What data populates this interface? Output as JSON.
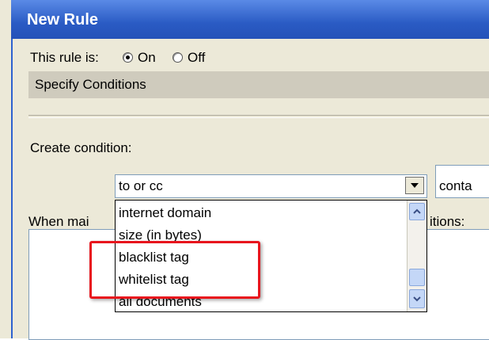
{
  "window": {
    "title": "New Rule"
  },
  "status_row": {
    "label": "This rule is:",
    "on_label": "On",
    "off_label": "Off",
    "selected": "On"
  },
  "section": {
    "header": "Specify Conditions"
  },
  "conditions": {
    "create_label": "Create condition:",
    "field_combo_value": "to or cc",
    "operator_combo_value": "conta",
    "when_label_left": "When mai",
    "when_label_right": "itions:"
  },
  "dropdown": {
    "items": [
      "internet domain",
      "size (in bytes)",
      "blacklist tag",
      "whitelist tag",
      "all documents"
    ]
  },
  "colors": {
    "title_bar": "#2a5bc4",
    "highlight": "#e8141d",
    "dialog_bg": "#ece9d8"
  }
}
